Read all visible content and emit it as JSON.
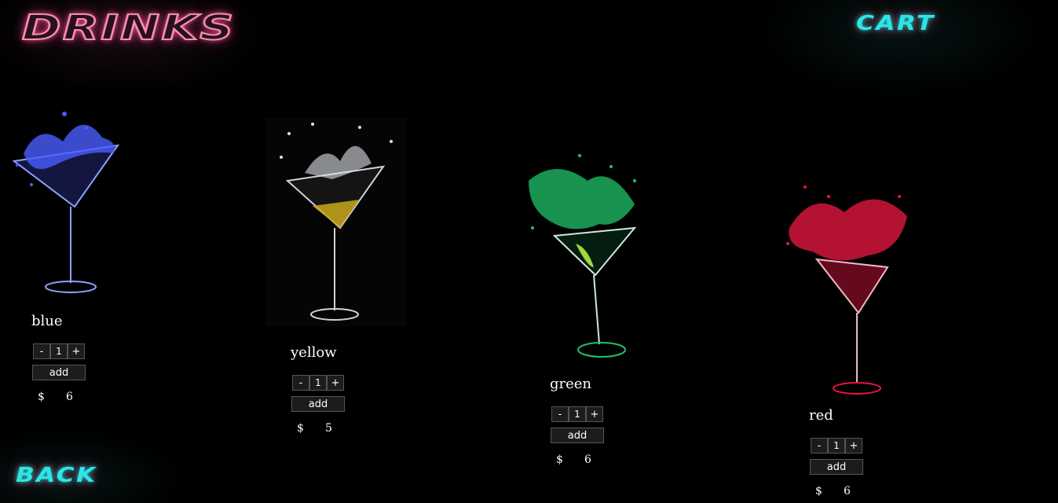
{
  "header": {
    "title": "DRINKS",
    "cart_label": "CART"
  },
  "footer": {
    "back_label": "BACK"
  },
  "products": [
    {
      "name": "blue",
      "qty": "1",
      "minus": "-",
      "plus": "+",
      "add_label": "add",
      "currency": "$",
      "price": "6",
      "color": "#4b5cff"
    },
    {
      "name": "yellow",
      "qty": "1",
      "minus": "-",
      "plus": "+",
      "add_label": "add",
      "currency": "$",
      "price": "5",
      "color": "#c9a81a"
    },
    {
      "name": "green",
      "qty": "1",
      "minus": "-",
      "plus": "+",
      "add_label": "add",
      "currency": "$",
      "price": "6",
      "color": "#1fc46a"
    },
    {
      "name": "red",
      "qty": "1",
      "minus": "-",
      "plus": "+",
      "add_label": "add",
      "currency": "$",
      "price": "6",
      "color": "#e0163f"
    }
  ]
}
